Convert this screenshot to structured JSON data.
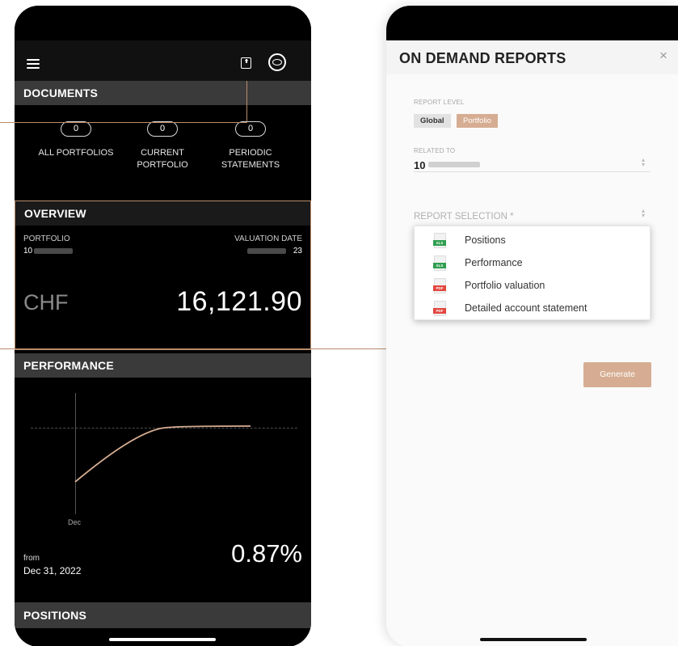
{
  "colors": {
    "accent": "#d6ad92",
    "connector": "#b98d6c",
    "xls": "#2e9e4f",
    "pdf": "#e2463f"
  },
  "left_phone": {
    "icons": [
      "menu-icon",
      "download-icon",
      "layers-icon"
    ],
    "documents": {
      "title": "DOCUMENTS",
      "items": [
        {
          "count": "0",
          "label_line1": "ALL PORTFOLIOS",
          "label_line2": ""
        },
        {
          "count": "0",
          "label_line1": "CURRENT",
          "label_line2": "PORTFOLIO"
        },
        {
          "count": "0",
          "label_line1": "PERIODIC",
          "label_line2": "STATEMENTS"
        }
      ]
    },
    "overview": {
      "title": "OVERVIEW",
      "portfolio_label": "PORTFOLIO",
      "portfolio_value": "10",
      "valuation_label": "VALUATION DATE",
      "valuation_value": "23",
      "currency": "CHF",
      "amount": "16,121.90"
    },
    "performance": {
      "title": "PERFORMANCE",
      "x_label": "Dec",
      "from_label": "from",
      "from_date": "Dec 31, 2022",
      "value": "0.87%"
    },
    "positions": {
      "title": "POSITIONS"
    }
  },
  "chart_data": {
    "type": "line",
    "x_ticks": [
      "Dec"
    ],
    "shape": "rising-then-flat"
  },
  "right_phone": {
    "title": "ON DEMAND REPORTS",
    "close": "×",
    "report_level": {
      "label": "REPORT LEVEL",
      "options": [
        "Global",
        "Portfolio"
      ],
      "selected": "Portfolio"
    },
    "related_to": {
      "label": "RELATED TO",
      "value": "10"
    },
    "report_selection": {
      "label": "REPORT SELECTION",
      "required": "*",
      "options": [
        {
          "label": "Positions",
          "type": "XLS"
        },
        {
          "label": "Performance",
          "type": "XLS"
        },
        {
          "label": "Portfolio valuation",
          "type": "PDF"
        },
        {
          "label": "Detailed account statement",
          "type": "PDF"
        }
      ]
    },
    "generate": "Generate"
  }
}
